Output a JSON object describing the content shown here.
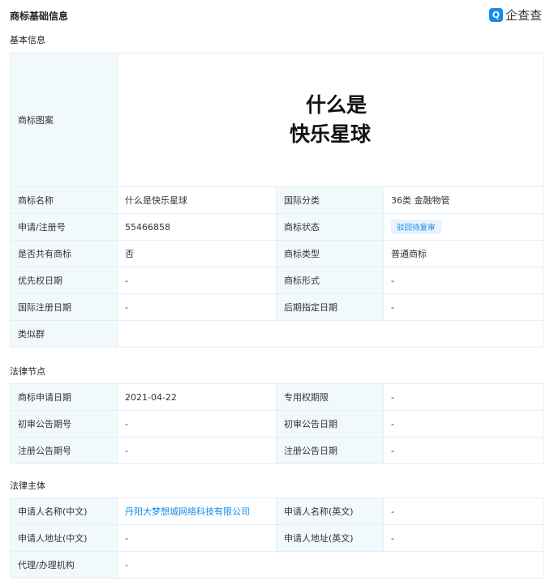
{
  "header": {
    "title": "商标基础信息",
    "brand_icon": "qcc-logo-icon",
    "brand_name": "企查查",
    "brand_color": "#128bed"
  },
  "basic": {
    "section_title": "基本信息",
    "image_label": "商标图案",
    "image_text_line1": "什么是",
    "image_text_line2": "快乐星球",
    "rows": [
      {
        "l1": "商标名称",
        "v1": "什么是快乐星球",
        "l2": "国际分类",
        "v2": "36类 金融物管"
      },
      {
        "l1": "申请/注册号",
        "v1": "55466858",
        "l2": "商标状态",
        "v2": "驳回待复审"
      },
      {
        "l1": "是否共有商标",
        "v1": "否",
        "l2": "商标类型",
        "v2": "普通商标"
      },
      {
        "l1": "优先权日期",
        "v1": "-",
        "l2": "商标形式",
        "v2": "-"
      },
      {
        "l1": "国际注册日期",
        "v1": "-",
        "l2": "后期指定日期",
        "v2": "-"
      }
    ],
    "similar_group_label": "类似群",
    "similar_group_value": ""
  },
  "legal_nodes": {
    "section_title": "法律节点",
    "rows": [
      {
        "l1": "商标申请日期",
        "v1": "2021-04-22",
        "l2": "专用权期限",
        "v2": "-"
      },
      {
        "l1": "初审公告期号",
        "v1": "-",
        "l2": "初审公告日期",
        "v2": "-"
      },
      {
        "l1": "注册公告期号",
        "v1": "-",
        "l2": "注册公告日期",
        "v2": "-"
      }
    ]
  },
  "legal_subject": {
    "section_title": "法律主体",
    "rows": [
      {
        "l1": "申请人名称(中文)",
        "v1": "丹阳大梦想城网络科技有限公司",
        "l2": "申请人名称(英文)",
        "v2": "-"
      },
      {
        "l1": "申请人地址(中文)",
        "v1": "-",
        "l2": "申请人地址(英文)",
        "v2": "-"
      }
    ],
    "agent_label": "代理/办理机构",
    "agent_value": "-"
  }
}
